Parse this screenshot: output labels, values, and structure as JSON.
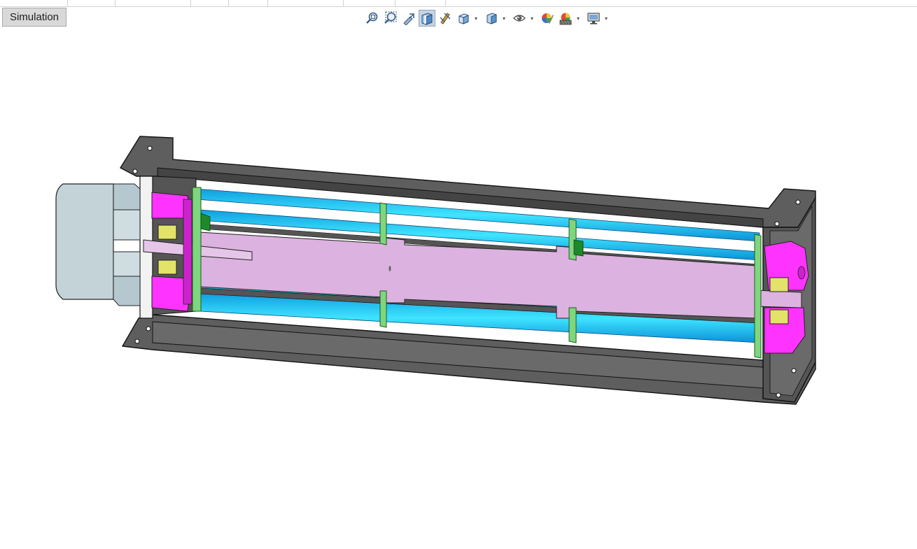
{
  "window": {
    "tabs": [
      "",
      "",
      "",
      "",
      "",
      "",
      "",
      ""
    ]
  },
  "simulation_tab": {
    "label": "Simulation"
  },
  "view_toolbar": {
    "buttons": [
      {
        "icon": "zoom-to-fit-icon"
      },
      {
        "icon": "zoom-to-area-icon"
      },
      {
        "icon": "previous-view-icon"
      },
      {
        "icon": "section-view-icon",
        "active": true
      },
      {
        "icon": "dynamic-annotation-views-icon"
      },
      {
        "icon": "view-orientation-icon",
        "dropdown": true
      },
      {
        "icon": "display-style-icon",
        "dropdown": true
      },
      {
        "icon": "hide-show-items-icon",
        "dropdown": true
      },
      {
        "icon": "edit-appearance-icon"
      },
      {
        "icon": "apply-scene-icon",
        "dropdown": true
      },
      {
        "icon": "view-settings-icon",
        "dropdown": true
      }
    ]
  },
  "colors": {
    "housing": "#5e5e5e",
    "housing_edge": "#1a1a1a",
    "impeller_blade": "#22c8f0",
    "impeller_ring": "#7ed67e",
    "shaft": "#dcb2e0",
    "bearing_housing": "#ff33ff",
    "bearing": "#e3e36a",
    "motor": "#c3d3d8"
  }
}
